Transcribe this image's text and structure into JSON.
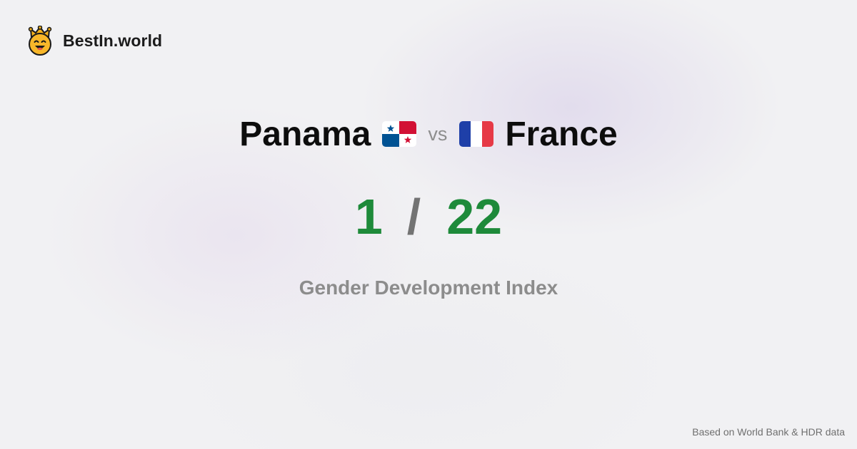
{
  "brand": {
    "name": "BestIn.world",
    "logo_icon": "crown-smiley-icon"
  },
  "comparison": {
    "left_country": "Panama",
    "left_flag_icon": "panama-flag-icon",
    "vs_label": "vs",
    "right_country": "France",
    "right_flag_icon": "france-flag-icon"
  },
  "scores": {
    "left_rank": "1",
    "separator": "/",
    "right_rank": "22"
  },
  "metric": {
    "label": "Gender Development Index"
  },
  "footer": {
    "source": "Based on World Bank & HDR data"
  },
  "colors": {
    "background": "#f1f1f3",
    "rank_green": "#1e8a3a",
    "muted_gray": "#8c8c8c",
    "text_dark": "#0d0d0d"
  }
}
